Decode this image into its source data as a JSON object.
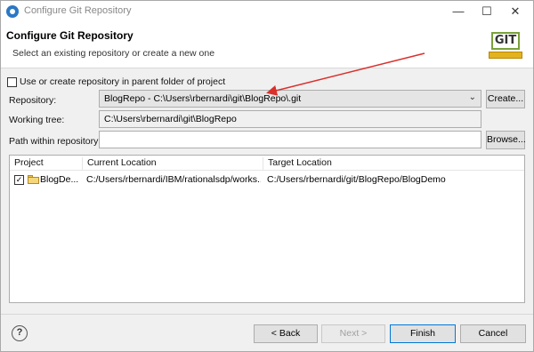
{
  "window": {
    "title": "Configure Git Repository",
    "controls": {
      "minimize": "—",
      "maximize": "☐",
      "close": "✕"
    }
  },
  "header": {
    "heading": "Configure Git Repository",
    "description": "Select an existing repository or create a new one",
    "logo_text": "GIT"
  },
  "options": {
    "use_parent_folder_label": "Use or create repository in parent folder of project",
    "use_parent_folder_checked": false
  },
  "repository": {
    "label": "Repository:",
    "value": "BlogRepo - C:\\Users\\rbernardi\\git\\BlogRepo\\.git",
    "create_label": "Create..."
  },
  "working_tree": {
    "label": "Working tree:",
    "value": "C:\\Users\\rbernardi\\git\\BlogRepo"
  },
  "path_within_repo": {
    "label": "Path within repository:",
    "value": "",
    "browse_label": "Browse..."
  },
  "table": {
    "columns": [
      "Project",
      "Current Location",
      "Target Location"
    ],
    "rows": [
      {
        "checked": true,
        "project": "BlogDe...",
        "current_location": "C:/Users/rbernardi/IBM/rationalsdp/works...",
        "target_location": "C:/Users/rbernardi/git/BlogRepo/BlogDemo"
      }
    ]
  },
  "footer": {
    "help": "?",
    "back_label": "< Back",
    "next_label": "Next >",
    "finish_label": "Finish",
    "cancel_label": "Cancel"
  },
  "colors": {
    "annotation_arrow": "#d9302c",
    "primary_button_border": "#0078d7"
  }
}
